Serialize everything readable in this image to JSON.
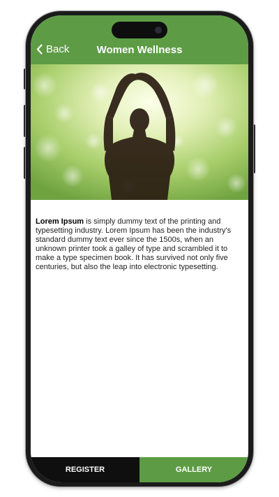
{
  "header": {
    "back_label": "Back",
    "title": "Women Wellness"
  },
  "hero": {
    "image": "woman-yoga-silhouette-bokeh"
  },
  "content": {
    "lead": "Lorem Ipsum",
    "body": " is simply dummy text of the printing and typesetting industry. Lorem Ipsum has been the industry's standard dummy text ever since the 1500s, when an unknown printer took a galley of type and scrambled it to make a type specimen book. It has survived not only five centuries, but also the leap into electronic typesetting."
  },
  "tabs": {
    "register": "REGISTER",
    "gallery": "GALLERY"
  },
  "colors": {
    "brand_green": "#5d9c45",
    "tab_dark": "#0f0f0f"
  },
  "icons": {
    "back": "chevron-left-icon"
  }
}
